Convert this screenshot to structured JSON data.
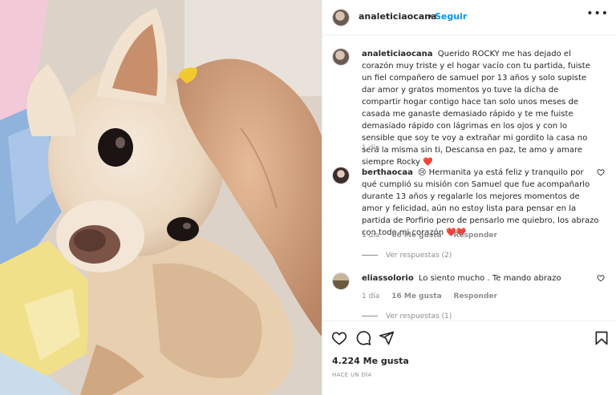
{
  "post": {
    "author": "analeticiaocana",
    "separator": "•",
    "follow_label": "Seguir",
    "more_icon": "more-horizontal-icon"
  },
  "caption": {
    "user": "analeticiaocana",
    "text": "Querido ROCKY me has dejado el corazón muy triste y el hogar vacío con tu partida, fuiste un fiel compañero de samuel por 13 años y solo supiste dar amor y gratos momentos yo tuve la dicha de compartir hogar contigo hace tan solo unos meses de casada me ganaste demasiado rápido y te me fuiste demasiado rápido con lágrimas en los ojos y con lo sensible que soy te voy a extrañar mi gordito la casa no será la misma sin ti, Descansa en paz, te amo y amare siempre Rocky",
    "emoji": "❤️",
    "time": "1 día"
  },
  "comments": [
    {
      "user": "berthaocaa",
      "emoji_lead": "😢",
      "text": "Hermanita ya está feliz y tranquilo por qué cumplió su misión con Samuel que fue acompañarlo durante 13 años y regalarle los mejores momentos de amor y felicidad, aún no estoy lista para pensar en la partida de Porfirio pero de pensarlo me quiebro, los abrazo con todo mi corazón",
      "emoji_tail": "❤️❤️",
      "time": "1 día",
      "likes": "66 Me gusta",
      "reply_label": "Responder",
      "view_replies": "Ver respuestas (2)"
    },
    {
      "user": "eliassolorio",
      "text": "Lo siento mucho . Te mando abrazo",
      "time": "1 día",
      "likes": "16 Me gusta",
      "reply_label": "Responder",
      "view_replies": "Ver respuestas (1)"
    }
  ],
  "footer": {
    "likes": "4.224 Me gusta",
    "when": "HACE UN DÍA",
    "icons": [
      "heart-icon",
      "comment-icon",
      "share-icon",
      "bookmark-icon"
    ]
  },
  "colors": {
    "link_blue": "#0095f6",
    "text": "#262626",
    "muted": "#8e8e8e",
    "heart_red": "#ed4956"
  }
}
